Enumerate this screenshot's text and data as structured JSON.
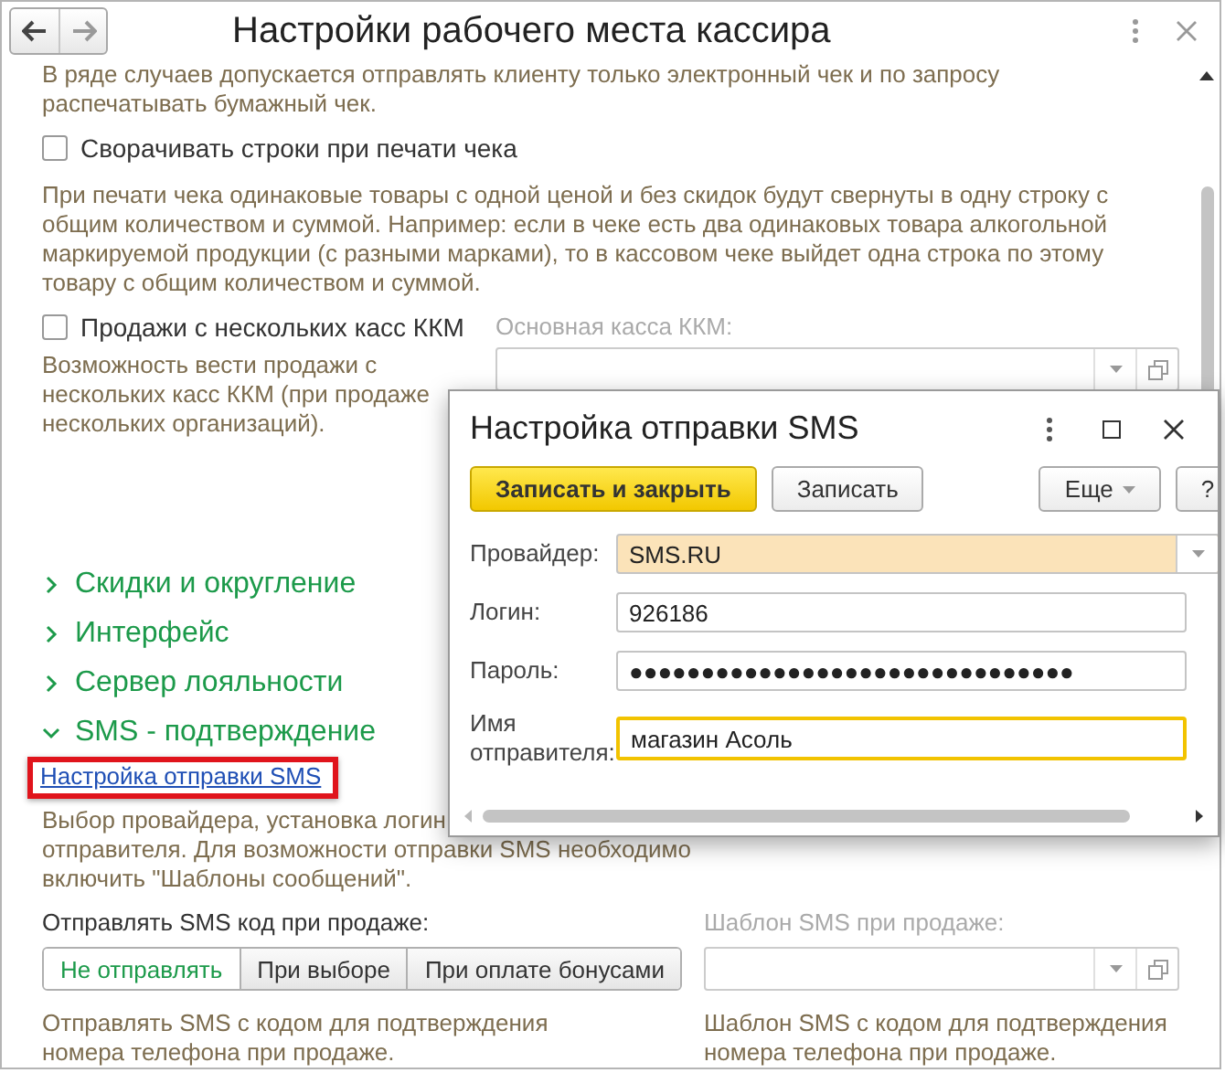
{
  "window": {
    "title": "Настройки рабочего места кассира"
  },
  "intro_lines": [
    "В ряде случаев допускается отправлять клиенту только электронный чек и по запросу",
    "распечатывать бумажный чек."
  ],
  "collapse_rows": {
    "label": "Сворачивать строки при печати чека",
    "checked": false,
    "description": "При печати чека одинаковые товары с одной ценой и без скидок будут свернуты в одну строку с общим количеством и суммой. Например: если в чеке есть два одинаковых товара алкогольной маркируемой продукции (с разными марками), то в кассовом чеке выйдет одна строка по этому товару с общим количеством и суммой."
  },
  "multi_kkm": {
    "label": "Продажи с нескольких касс ККМ",
    "checked": false,
    "description": "Возможность вести продажи с нескольких касс ККМ (при продаже нескольких организаций).",
    "main_kkm_label": "Основная касса ККМ:"
  },
  "groups": [
    {
      "label": "Скидки и округление",
      "expanded": false
    },
    {
      "label": "Интерфейс",
      "expanded": false
    },
    {
      "label": "Сервер лояльности",
      "expanded": false
    },
    {
      "label": "SMS - подтверждение",
      "expanded": true
    }
  ],
  "sms": {
    "link": "Настройка отправки SMS",
    "description_lines": [
      "Выбор провайдера, установка логин",
      "отправителя. Для возможности отправки SMS необходимо",
      "включить \"Шаблоны сообщений\"."
    ],
    "send_label": "Отправлять SMS код при продаже:",
    "send_options": [
      {
        "label": "Не отправлять",
        "selected": true
      },
      {
        "label": "При выборе",
        "selected": false
      },
      {
        "label": "При оплате бонусами",
        "selected": false
      }
    ],
    "send_description": "Отправлять SMS с кодом для подтверждения номера телефона при продаже.",
    "template_label": "Шаблон SMS при продаже:",
    "template_description": "Шаблон SMS с кодом для подтверждения номера телефона при продаже."
  },
  "dialog": {
    "title": "Настройка отправки SMS",
    "buttons": [
      {
        "label": "Записать и закрыть",
        "kind": "primary"
      },
      {
        "label": "Записать",
        "kind": "plain"
      },
      {
        "label": "Еще",
        "kind": "menu"
      },
      {
        "label": "?",
        "kind": "help"
      }
    ],
    "fields": [
      {
        "label": "Провайдер:",
        "value": "SMS.RU",
        "kind": "select"
      },
      {
        "label": "Логин:",
        "value": "926186",
        "kind": "text"
      },
      {
        "label": "Пароль:",
        "value": "●●●●●●●●●●●●●●●●●●●●●●●●●●●●●●●",
        "kind": "text"
      },
      {
        "label": "Имя отправителя:",
        "value": "магазин Асоль",
        "kind": "focused"
      }
    ]
  }
}
